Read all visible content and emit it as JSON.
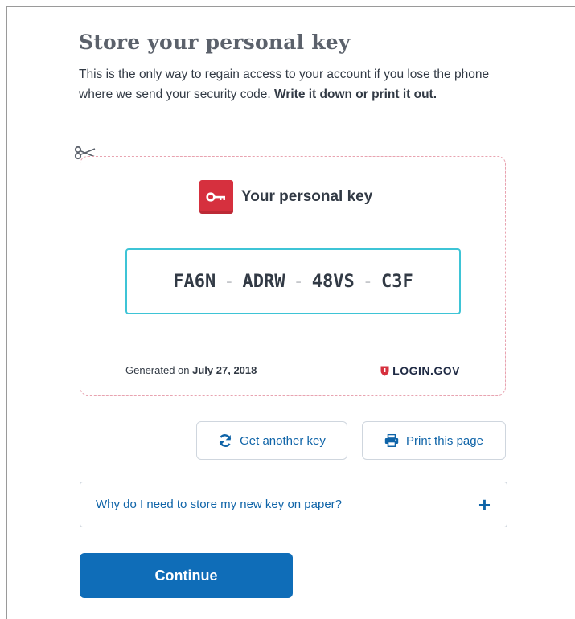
{
  "title": "Store your personal key",
  "intro": {
    "text": "This is the only way to regain access to your account if you lose the phone where we send your security code.",
    "emphasis": "Write it down or print it out."
  },
  "card": {
    "header": "Your personal key",
    "key_parts": [
      "FA6N",
      "ADRW",
      "48VS",
      "C3F"
    ],
    "generated_label": "Generated on",
    "generated_date": "July 27, 2018",
    "brand": "LOGIN.GOV"
  },
  "actions": {
    "get_another_label": "Get another key",
    "print_label": "Print this page"
  },
  "accordion": {
    "label": "Why do I need to store my new key on paper?",
    "toggle_symbol": "+"
  },
  "continue_label": "Continue",
  "colors": {
    "primary": "#0f6db8",
    "link": "#0f64a8",
    "accent_red": "#d6303e",
    "code_border": "#3ec4d6",
    "dashed_border": "#e8a3b0"
  },
  "icons": {
    "cut": "scissors-icon",
    "key": "key-icon",
    "refresh": "refresh-icon",
    "print": "printer-icon",
    "brand": "shield-icon"
  }
}
